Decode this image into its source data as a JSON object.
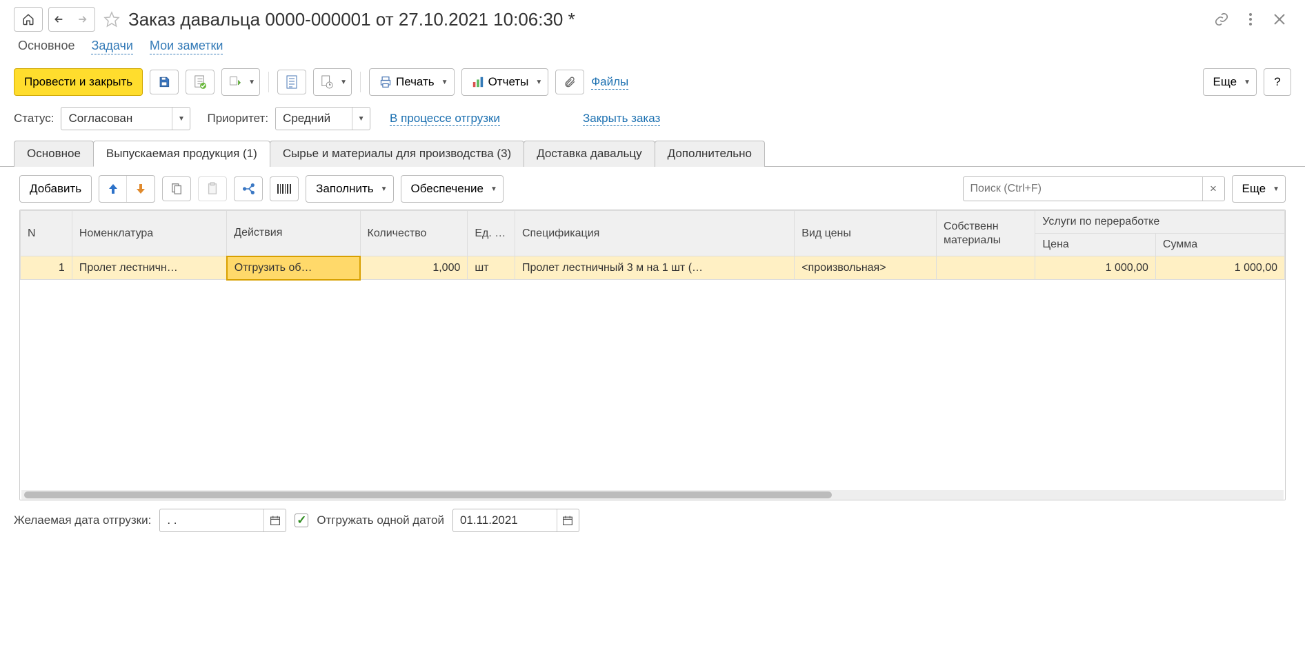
{
  "header": {
    "title": "Заказ давальца 0000-000001 от 27.10.2021 10:06:30 *"
  },
  "nav": {
    "main": "Основное",
    "tasks": "Задачи",
    "notes": "Мои заметки"
  },
  "toolbar": {
    "post_and_close": "Провести и закрыть",
    "print": "Печать",
    "reports": "Отчеты",
    "files": "Файлы",
    "more": "Еще",
    "help": "?"
  },
  "status_row": {
    "status_label": "Статус:",
    "status_value": "Согласован",
    "priority_label": "Приоритет:",
    "priority_value": "Средний",
    "shipping": "В процессе отгрузки",
    "close_order": "Закрыть заказ"
  },
  "tabs": {
    "t0": "Основное",
    "t1": "Выпускаемая продукция (1)",
    "t2": "Сырье и материалы для производства (3)",
    "t3": "Доставка давальцу",
    "t4": "Дополнительно"
  },
  "tab_toolbar": {
    "add": "Добавить",
    "fill": "Заполнить",
    "supply": "Обеспечение",
    "search_placeholder": "Поиск (Ctrl+F)",
    "more": "Еще"
  },
  "grid": {
    "headers": {
      "n": "N",
      "item": "Номенклатура",
      "actions": "Действия",
      "qty": "Количество",
      "uom": "Ед. изм.",
      "spec": "Спецификация",
      "price_type": "Вид цены",
      "own_materials": "Собственн материалы",
      "services": "Услуги по переработке",
      "price": "Цена",
      "sum": "Сумма"
    },
    "row": {
      "n": "1",
      "item": "Пролет лестничн…",
      "actions": "Отгрузить об…",
      "qty": "1,000",
      "uom": "шт",
      "spec": "Пролет лестничный 3 м на 1 шт (…",
      "price_type": "<произвольная>",
      "own_materials": "",
      "price": "1 000,00",
      "sum": "1 000,00"
    }
  },
  "footer": {
    "desired_date_label": "Желаемая дата отгрузки:",
    "desired_date_value": ". .",
    "single_date_label": "Отгружать одной датой",
    "single_date_value": "01.11.2021"
  }
}
